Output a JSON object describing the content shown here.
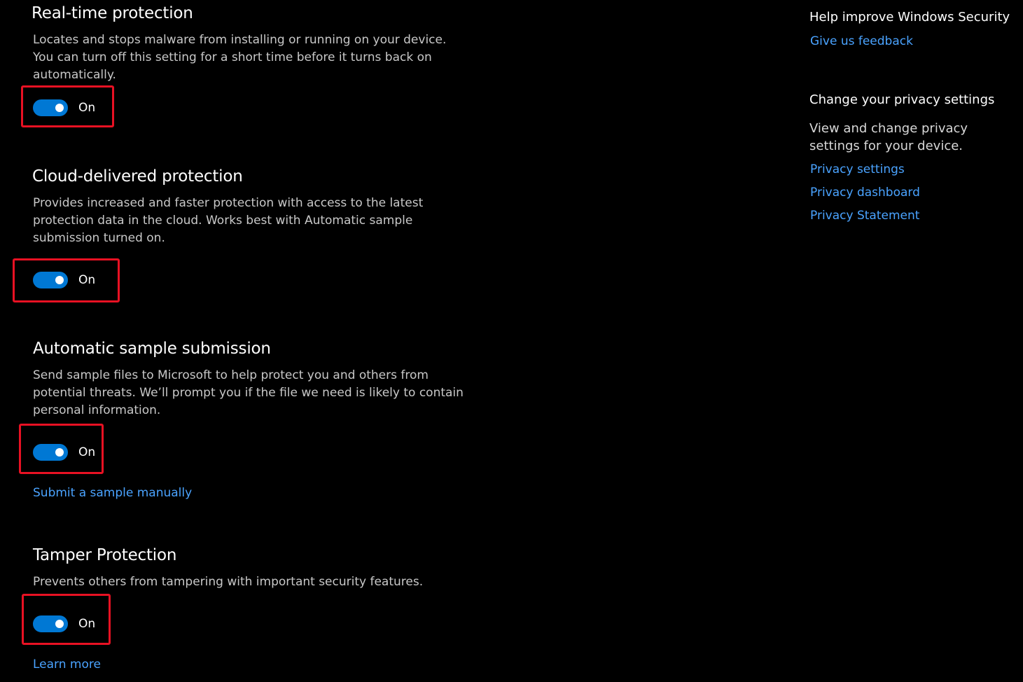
{
  "accent_color": "#0078d4",
  "link_color": "#4aa3ff",
  "highlight_color": "#e81123",
  "sections": [
    {
      "title": "Real-time protection",
      "description": "Locates and stops malware from installing or running on your device. You can turn off this setting for a short time before it turns back on automatically.",
      "toggle_state": "On",
      "toggle_on": true
    },
    {
      "title": "Cloud-delivered protection",
      "description": "Provides increased and faster protection with access to the latest protection data in the cloud. Works best with Automatic sample submission turned on.",
      "toggle_state": "On",
      "toggle_on": true
    },
    {
      "title": "Automatic sample submission",
      "description": "Send sample files to Microsoft to help protect you and others from potential threats. We’ll prompt you if the file we need is likely to contain personal information.",
      "toggle_state": "On",
      "toggle_on": true,
      "link": "Submit a sample manually"
    },
    {
      "title": "Tamper Protection",
      "description": "Prevents others from tampering with important security features.",
      "toggle_state": "On",
      "toggle_on": true,
      "link": "Learn more"
    }
  ],
  "sidebar": {
    "help_heading": "Help improve Windows Security",
    "feedback_link": "Give us feedback",
    "privacy_heading": "Change your privacy settings",
    "privacy_text": "View and change privacy settings for your  device.",
    "privacy_links": [
      "Privacy settings",
      "Privacy dashboard",
      "Privacy Statement"
    ]
  }
}
